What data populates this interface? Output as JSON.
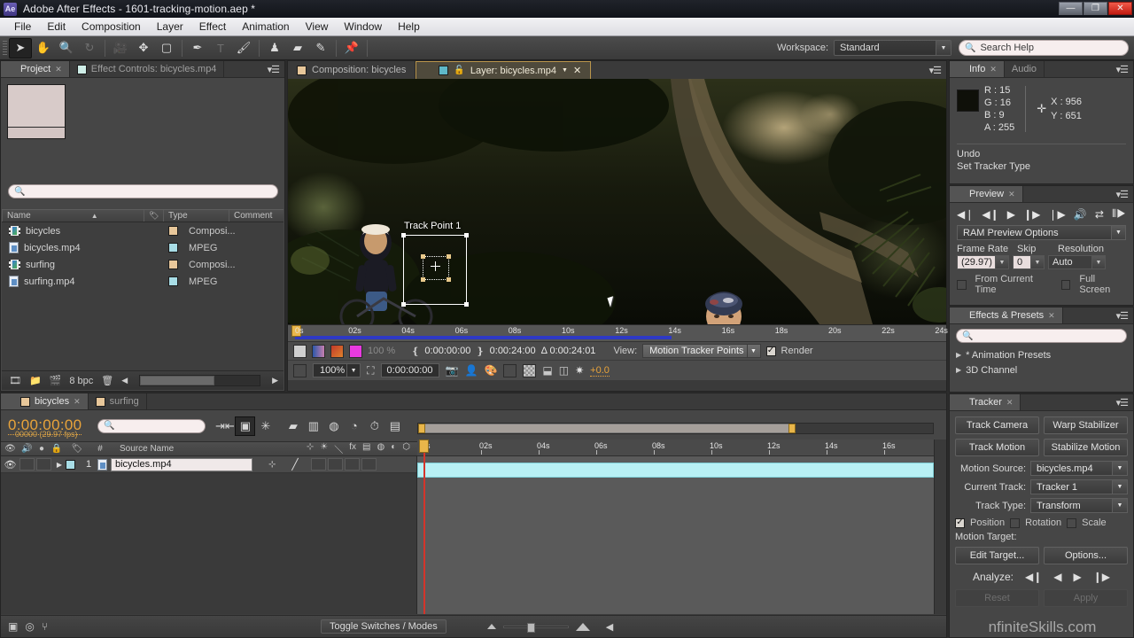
{
  "window": {
    "app_badge": "Ae",
    "title": "Adobe After Effects - 1601-tracking-motion.aep *",
    "minimize": "—",
    "restore": "❐",
    "close": "✕"
  },
  "menubar": {
    "items": [
      "File",
      "Edit",
      "Composition",
      "Layer",
      "Effect",
      "Animation",
      "View",
      "Window",
      "Help"
    ]
  },
  "toolbar": {
    "tools": [
      {
        "name": "selection-tool",
        "glyph": "➤",
        "active": true
      },
      {
        "name": "hand-tool",
        "glyph": "✋",
        "active": false
      },
      {
        "name": "zoom-tool",
        "glyph": "🔍",
        "active": false
      },
      {
        "name": "rotation-tool",
        "glyph": "↻",
        "active": false,
        "dim": true
      },
      {
        "name": "camera-tool",
        "glyph": "🎥",
        "active": false,
        "dim": true
      },
      {
        "name": "pan-behind-tool",
        "glyph": "✥",
        "active": false
      },
      {
        "name": "rectangle-tool",
        "glyph": "▢",
        "active": false
      },
      {
        "name": "pen-tool",
        "glyph": "✒",
        "active": false
      },
      {
        "name": "type-tool",
        "glyph": "T",
        "active": false,
        "dim": true
      },
      {
        "name": "brush-tool",
        "glyph": "🖌",
        "active": false
      },
      {
        "name": "clone-stamp-tool",
        "glyph": "♟",
        "active": false
      },
      {
        "name": "eraser-tool",
        "glyph": "▰",
        "active": false
      },
      {
        "name": "roto-brush-tool",
        "glyph": "✎",
        "active": false
      },
      {
        "name": "puppet-pin-tool",
        "glyph": "📌",
        "active": false
      }
    ],
    "workspace_label": "Workspace:",
    "workspace_value": "Standard",
    "search_help_placeholder": "Search Help"
  },
  "project_panel": {
    "tabs": [
      {
        "label": "Project",
        "active": true,
        "closable": true
      },
      {
        "label": "Effect Controls: bicycles.mp4",
        "active": false,
        "closable": false
      }
    ],
    "search_placeholder": "",
    "columns": [
      "Name",
      "Type",
      "Comment"
    ],
    "items": [
      {
        "name": "bicycles",
        "type": "Composi...",
        "icon": "composition-icon",
        "swatch": "#e8c79a"
      },
      {
        "name": "bicycles.mp4",
        "type": "MPEG",
        "icon": "footage-icon",
        "swatch": "#a8dde6"
      },
      {
        "name": "surfing",
        "type": "Composi...",
        "icon": "composition-icon",
        "swatch": "#e8c79a"
      },
      {
        "name": "surfing.mp4",
        "type": "MPEG",
        "icon": "footage-icon",
        "swatch": "#a8dde6"
      }
    ],
    "bit_depth": "8 bpc"
  },
  "viewer": {
    "tabs": [
      {
        "label": "Composition: bicycles",
        "active": false,
        "swatch": "#e8c79a"
      },
      {
        "label": "Layer: bicycles.mp4",
        "active": true,
        "swatch": "#5fb8c8"
      }
    ],
    "track_point_label": "Track Point 1",
    "timeline_ticks": [
      "0s",
      "02s",
      "04s",
      "06s",
      "08s",
      "10s",
      "12s",
      "14s",
      "16s",
      "18s",
      "20s",
      "22s",
      "24s"
    ],
    "opacity_value": "100 %",
    "in_point": "0:00:00:00",
    "out_point": "0:00:24:00",
    "duration_label": "Δ 0:00:24:01",
    "view_label": "View:",
    "view_value": "Motion Tracker Points",
    "render_label": "Render",
    "render_checked": true,
    "zoom_value": "100%",
    "current_time": "0:00:00:00",
    "exposure": "+0.0"
  },
  "info_panel": {
    "tabs": [
      {
        "label": "Info",
        "active": true,
        "closable": true
      },
      {
        "label": "Audio",
        "active": false,
        "closable": false
      }
    ],
    "r": "R : 15",
    "g": "G : 16",
    "b": "B : 9",
    "a": "A : 255",
    "x": "X : 956",
    "y": "Y : 651",
    "undo_label": "Undo",
    "undo_action": "Set Tracker Type",
    "swatch_color": "#0f1009"
  },
  "preview_panel": {
    "tab": "Preview",
    "transport": [
      {
        "name": "first-frame-button",
        "glyph": "◀❘"
      },
      {
        "name": "previous-frame-button",
        "glyph": "◀❙"
      },
      {
        "name": "play-button",
        "glyph": "▶"
      },
      {
        "name": "next-frame-button",
        "glyph": "❙▶"
      },
      {
        "name": "last-frame-button",
        "glyph": "❘▶"
      },
      {
        "name": "audio-button",
        "glyph": "🔊"
      },
      {
        "name": "loop-button",
        "glyph": "⇄"
      },
      {
        "name": "ram-preview-button",
        "glyph": "⦀▶"
      }
    ],
    "ram_preview_options": "RAM Preview Options",
    "frame_rate_label": "Frame Rate",
    "frame_rate_value": "(29.97)",
    "skip_label": "Skip",
    "skip_value": "0",
    "resolution_label": "Resolution",
    "resolution_value": "Auto",
    "from_current_time_label": "From Current Time",
    "from_current_time_checked": false,
    "full_screen_label": "Full Screen",
    "full_screen_checked": false
  },
  "effects_panel": {
    "tab": "Effects & Presets",
    "search_placeholder": "",
    "items": [
      "* Animation Presets",
      "3D Channel"
    ]
  },
  "tracker_panel": {
    "tab": "Tracker",
    "track_camera": "Track Camera",
    "warp_stabilizer": "Warp Stabilizer",
    "track_motion": "Track Motion",
    "stabilize_motion": "Stabilize Motion",
    "motion_source_label": "Motion Source:",
    "motion_source_value": "bicycles.mp4",
    "current_track_label": "Current Track:",
    "current_track_value": "Tracker 1",
    "track_type_label": "Track Type:",
    "track_type_value": "Transform",
    "position_label": "Position",
    "position_checked": true,
    "rotation_label": "Rotation",
    "rotation_checked": false,
    "scale_label": "Scale",
    "scale_checked": false,
    "motion_target_label": "Motion Target:",
    "edit_target": "Edit Target...",
    "options": "Options...",
    "analyze_label": "Analyze:",
    "analyze_buttons": [
      "◀❙",
      "◀",
      "▶",
      "❙▶"
    ],
    "reset": "Reset",
    "apply": "Apply",
    "watermark": "nfiniteSkills.com"
  },
  "timeline_panel": {
    "tabs": [
      {
        "label": "bicycles",
        "active": true,
        "closable": true,
        "swatch": "#e8c79a"
      },
      {
        "label": "surfing",
        "active": false,
        "closable": false,
        "swatch": "#e8c79a"
      }
    ],
    "current_time": "0:00:00:00",
    "frame_info": "00000 (29.97 fps)",
    "search_placeholder": "",
    "columns": [
      "#",
      "Source Name"
    ],
    "switch_icons": [
      "⊹",
      "☀",
      "＼",
      "fx",
      "▤",
      "◍",
      "◐",
      "⬡"
    ],
    "layers": [
      {
        "index": "1",
        "name": "bicycles.mp4",
        "swatch": "#a8dde6",
        "visible": true
      }
    ],
    "ruler_ticks": [
      "0s",
      "02s",
      "04s",
      "06s",
      "08s",
      "10s",
      "12s",
      "14s",
      "16s"
    ],
    "toggle_switches_modes": "Toggle Switches / Modes"
  }
}
